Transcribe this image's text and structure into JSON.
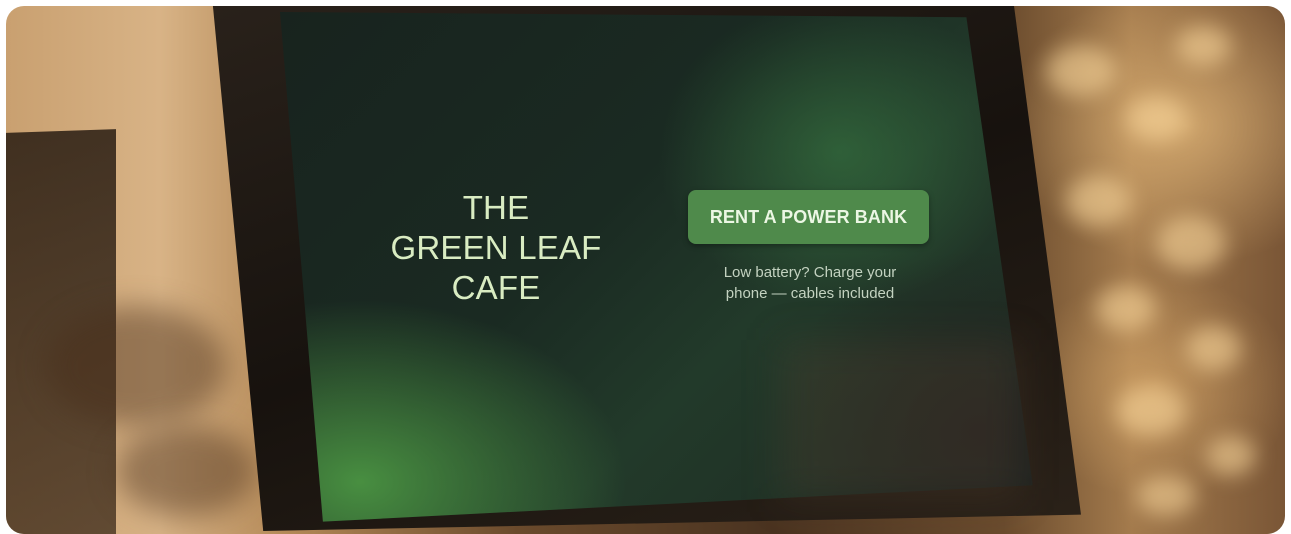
{
  "kiosk": {
    "title_lines": [
      "THE",
      "GREEN LEAF",
      "CAFE"
    ],
    "button_label": "RENT A POWER BANK",
    "subtext_lines": [
      "Low battery? Charge your",
      "phone — cables included"
    ]
  },
  "colors": {
    "button": "#4f8a4b",
    "title_text": "#d9ecc2",
    "subtext": "#c3d2c0"
  }
}
